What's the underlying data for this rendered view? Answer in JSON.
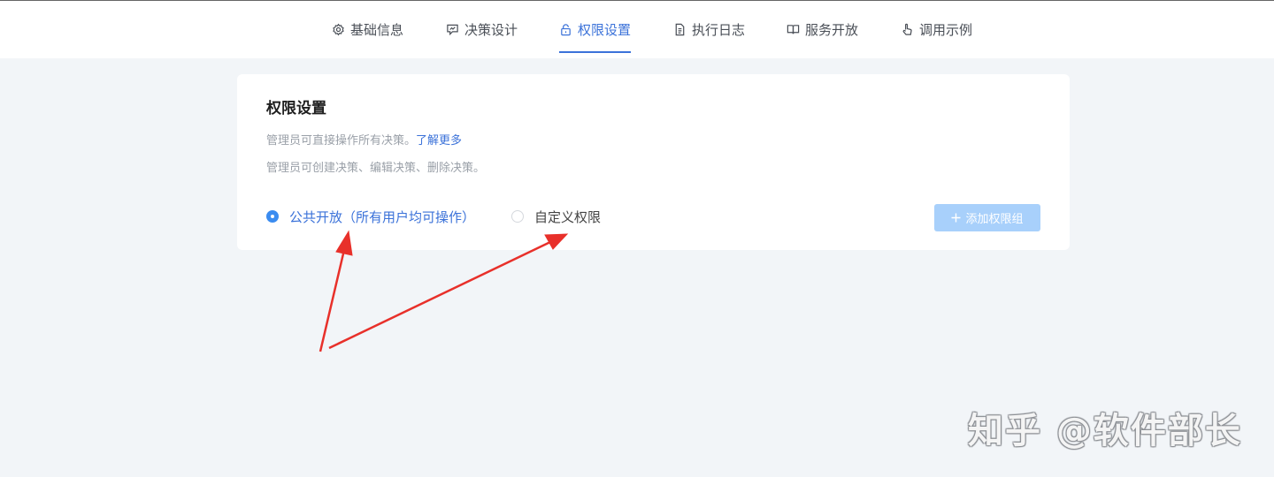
{
  "nav": {
    "tabs": [
      {
        "label": "基础信息",
        "icon": "settings-icon"
      },
      {
        "label": "决策设计",
        "icon": "design-icon"
      },
      {
        "label": "权限设置",
        "icon": "lock-icon",
        "active": true
      },
      {
        "label": "执行日志",
        "icon": "document-icon"
      },
      {
        "label": "服务开放",
        "icon": "book-icon"
      },
      {
        "label": "调用示例",
        "icon": "hand-pointer-icon"
      }
    ]
  },
  "permissions": {
    "title": "权限设置",
    "desc_line1": "管理员可直接操作所有决策。",
    "learn_more": "了解更多",
    "desc_line2": "管理员可创建决策、编辑决策、删除决策。",
    "option_public": "公共开放（所有用户均可操作）",
    "option_custom": "自定义权限",
    "selected": "public",
    "add_group_button": "添加权限组"
  },
  "annotation": {
    "arrow_color": "#e8302a"
  },
  "watermark": "知乎 @软件部长",
  "colors": {
    "accent": "#3b72d9",
    "radio": "#3b8cf0",
    "button_disabled": "#a8d0fb",
    "background": "#f2f5f8"
  }
}
